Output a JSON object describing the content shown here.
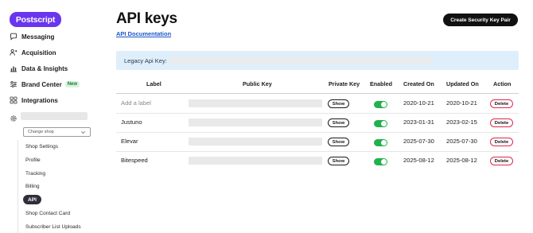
{
  "sidebar": {
    "logo": "Postscript",
    "nav": [
      {
        "label": "Messaging",
        "icon": "chat-bubble-icon"
      },
      {
        "label": "Acquisition",
        "icon": "users-icon"
      },
      {
        "label": "Data & Insights",
        "icon": "bar-chart-icon"
      },
      {
        "label": "Brand Center",
        "icon": "sliders-icon",
        "badge": "New"
      },
      {
        "label": "Integrations",
        "icon": "grid-icon"
      }
    ],
    "shop_select": "Change shop",
    "subnav": [
      {
        "label": "Shop Settings"
      },
      {
        "label": "Profile"
      },
      {
        "label": "Tracking"
      },
      {
        "label": "Billing"
      },
      {
        "label": "API",
        "active": true
      },
      {
        "label": "Shop Contact Card"
      },
      {
        "label": "Subscriber List Uploads"
      }
    ]
  },
  "main": {
    "title": "API keys",
    "doc_link": "API Documentation",
    "create_button": "Create Security Key Pair",
    "legacy_label": "Legacy Api Key:",
    "table": {
      "headers": [
        "Label",
        "Public Key",
        "Private Key",
        "Enabled",
        "Created On",
        "Updated On",
        "Action"
      ],
      "rows": [
        {
          "label": "Add a label",
          "placeholder": true,
          "show": "Show",
          "enabled": true,
          "created": "2020-10-21",
          "updated": "2020-10-21",
          "action": "Delete"
        },
        {
          "label": "Justuno",
          "placeholder": false,
          "show": "Show",
          "enabled": true,
          "created": "2023-01-31",
          "updated": "2023-02-15",
          "action": "Delete"
        },
        {
          "label": "Elevar",
          "placeholder": false,
          "show": "Show",
          "enabled": true,
          "created": "2025-07-30",
          "updated": "2025-07-30",
          "action": "Delete"
        },
        {
          "label": "Bitespeed",
          "placeholder": false,
          "show": "Show",
          "enabled": true,
          "created": "2025-08-12",
          "updated": "2025-08-12",
          "action": "Delete"
        }
      ]
    }
  },
  "colors": {
    "brand": "#6a35ee",
    "link": "#1a56c8",
    "toggle_on": "#22b14c",
    "delete_border": "#e0264a",
    "legacy_bg": "#dfeefb"
  }
}
